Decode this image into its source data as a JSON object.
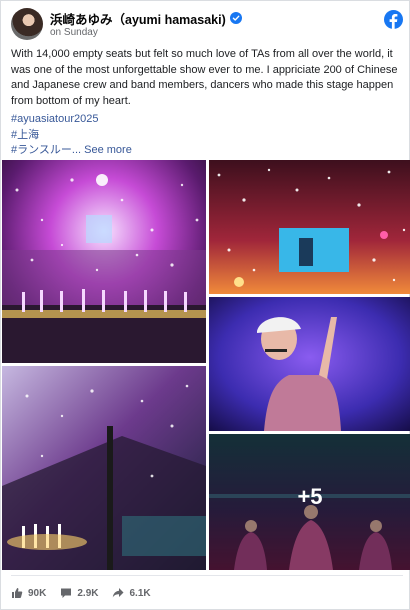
{
  "post": {
    "author": "浜崎あゆみ（ayumi hamasaki)",
    "date": "on Sunday",
    "body": "With 14,000 empty seats but felt so much love of TAs from all over the world, it was one of the most unforgettable show ever to me. I appriciate 200 of Chinese and Japanese crew and band members, dancers who made this stage happen from bottom of my heart.",
    "hashtags": [
      "#ayuasiatour2025",
      "#上海"
    ],
    "last_hashtag": "#ランスルー...",
    "see_more": "See more"
  },
  "photos": {
    "extra_count": "+5"
  },
  "stats": {
    "likes": "90K",
    "comments": "2.9K",
    "shares": "6.1K"
  },
  "icons": {
    "verified": "verified-badge-icon",
    "facebook": "facebook-logo-icon",
    "like": "thumbs-up-icon",
    "comment": "comment-bubble-icon",
    "share": "share-arrow-icon"
  },
  "colors": {
    "link": "#385898",
    "facebook_blue": "#1877f2",
    "muted": "#65676b"
  }
}
